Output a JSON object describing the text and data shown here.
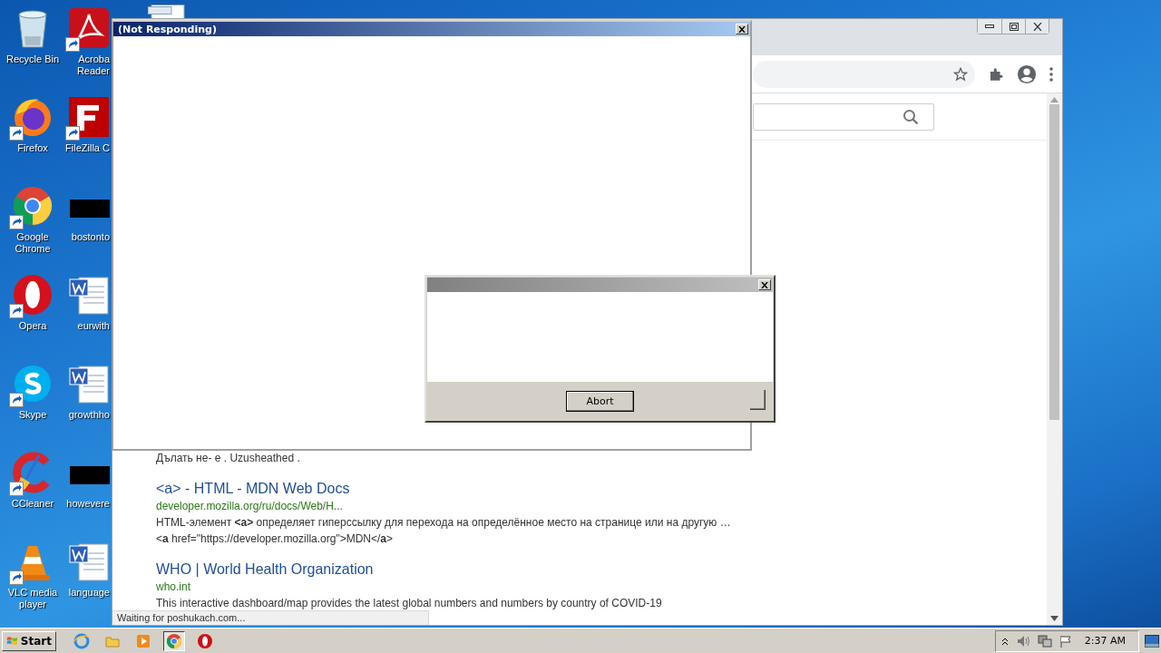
{
  "desktop": {
    "icons": [
      {
        "kind": "recycle-bin",
        "label": "Recycle Bin",
        "shortcut": false
      },
      {
        "kind": "pdf",
        "label": "Acroba\nReader",
        "shortcut": true
      },
      {
        "kind": "firefox",
        "label": "Firefox",
        "shortcut": true
      },
      {
        "kind": "filezilla",
        "label": "FileZilla C",
        "shortcut": true
      },
      {
        "kind": "chrome",
        "label": "Google Chrome",
        "shortcut": true
      },
      {
        "kind": "blank",
        "label": "bostonto",
        "shortcut": false
      },
      {
        "kind": "opera",
        "label": "Opera",
        "shortcut": true
      },
      {
        "kind": "word",
        "label": "eurwith",
        "shortcut": false
      },
      {
        "kind": "skype",
        "label": "Skype",
        "shortcut": true
      },
      {
        "kind": "word",
        "label": "growthho",
        "shortcut": false
      },
      {
        "kind": "ccleaner",
        "label": "CCleaner",
        "shortcut": true
      },
      {
        "kind": "blank",
        "label": "howevere",
        "shortcut": false
      },
      {
        "kind": "vlc",
        "label": "VLC media player",
        "shortcut": true
      },
      {
        "kind": "word",
        "label": "language",
        "shortcut": false
      }
    ]
  },
  "browser": {
    "results": [
      {
        "kind": "snippet",
        "text": "Дълать не- е . Uzusheathed ."
      },
      {
        "kind": "title",
        "text": "<a> - HTML - MDN Web Docs"
      },
      {
        "kind": "url",
        "text": "developer.mozilla.org/ru/docs/Web/H..."
      },
      {
        "kind": "snippet",
        "text": "HTML-элемент **<a>** определяет гиперссылку для перехода на определённое место на странице или на другую … <**a** href=\"https://developer.mozilla.org\">MDN</**a**>"
      },
      {
        "kind": "title",
        "text": "WHO | World Health Organization"
      },
      {
        "kind": "url",
        "text": "who.int"
      },
      {
        "kind": "snippet",
        "text": "This interactive dashboard/map provides the latest global numbers and numbers by country of COVID-19"
      }
    ],
    "status": "Waiting for poshukach.com..."
  },
  "hung_window": {
    "title": "(Not Responding)"
  },
  "dialog": {
    "buttons": [
      "Abort"
    ]
  },
  "taskbar": {
    "start": "Start",
    "apps": [
      {
        "kind": "ie",
        "selected": false
      },
      {
        "kind": "folder",
        "selected": false
      },
      {
        "kind": "media",
        "selected": false
      },
      {
        "kind": "chrome",
        "selected": true
      },
      {
        "kind": "opera",
        "selected": false
      }
    ],
    "clock": "2:37 AM"
  }
}
